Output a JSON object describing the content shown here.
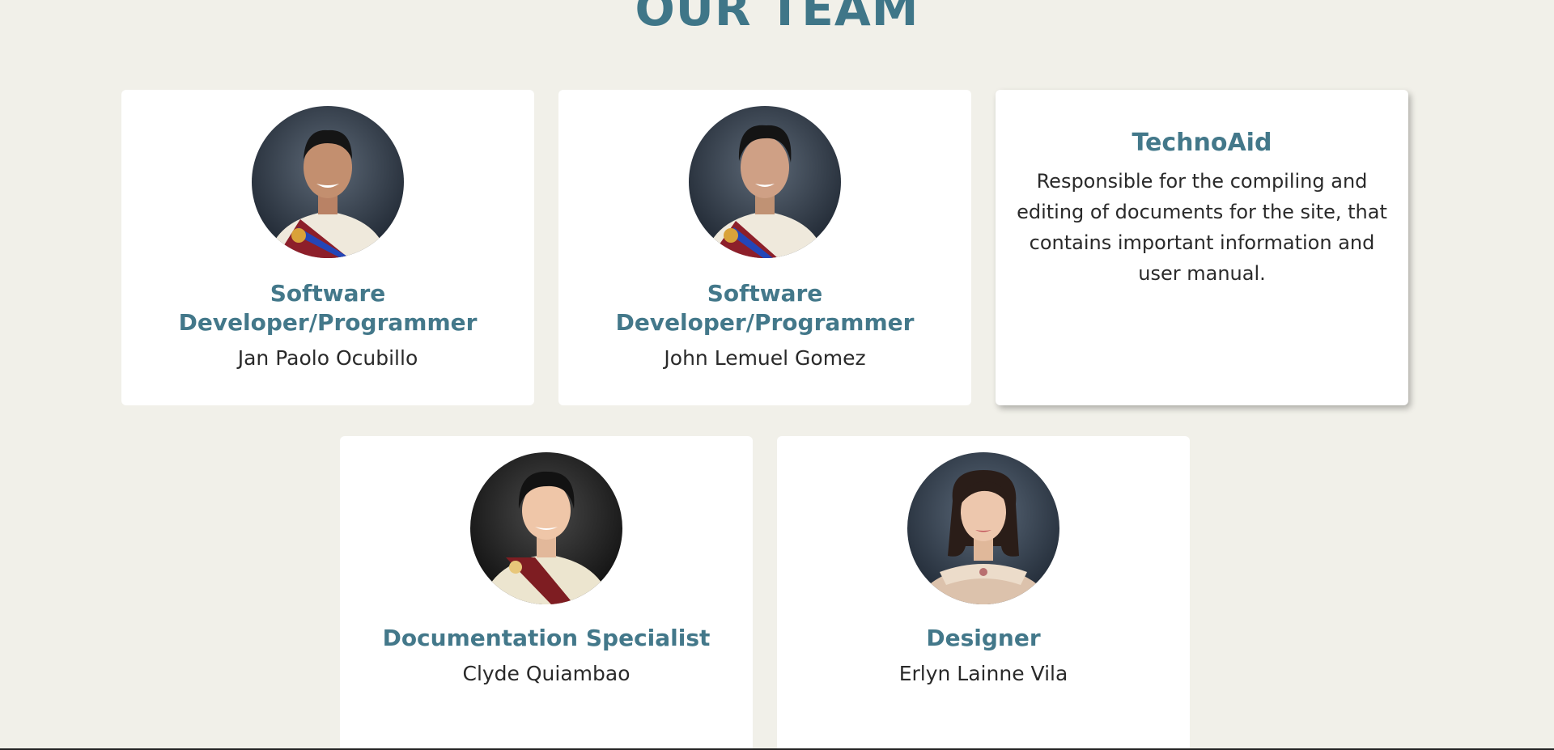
{
  "section": {
    "title": "OUR TEAM"
  },
  "members": [
    {
      "role": "Software Developer/Programmer",
      "name": "Jan Paolo Ocubillo"
    },
    {
      "role": "Software Developer/Programmer",
      "name": "John Lemuel Gomez"
    },
    {
      "role": "Documentation Specialist",
      "name": "Clyde Quiambao"
    },
    {
      "role": "Designer",
      "name": "Erlyn Lainne Vila"
    }
  ],
  "technoaid": {
    "title": "TechnoAid",
    "description": "Responsible for the compiling and editing of documents for the site, that contains important information and user manual."
  },
  "colors": {
    "background": "#f1f0e9",
    "accent": "#43788a",
    "card": "#ffffff",
    "text": "#2a2a2a"
  }
}
